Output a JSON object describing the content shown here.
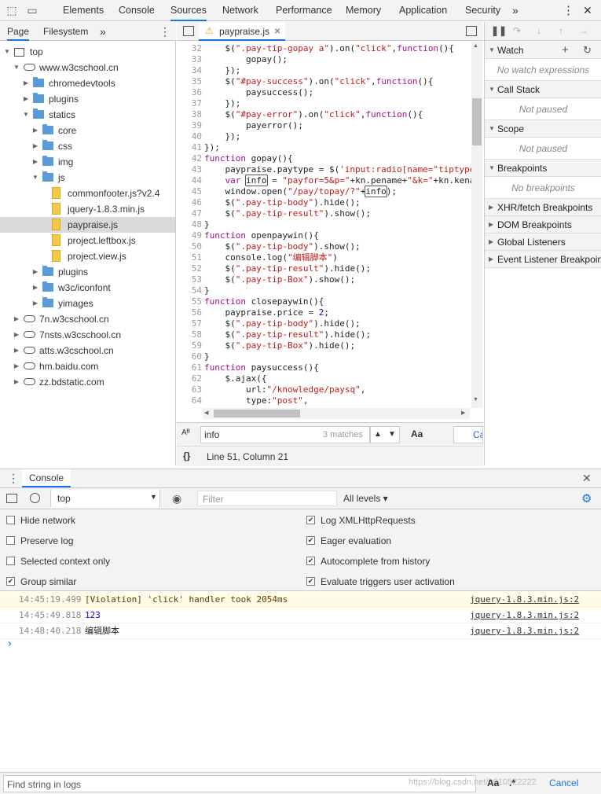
{
  "topbar": {
    "tabs": [
      "Elements",
      "Console",
      "Sources",
      "Network",
      "Performance",
      "Memory",
      "Application",
      "Security"
    ],
    "active": "Sources",
    "more": "»",
    "menu": "⋮",
    "close": "✕"
  },
  "navigator": {
    "tabs": [
      "Page",
      "Filesystem"
    ],
    "more": "»",
    "menu": "⋮",
    "tree": [
      {
        "label": "top",
        "icon": "frame",
        "depth": 0,
        "open": true
      },
      {
        "label": "www.w3cschool.cn",
        "icon": "cloud",
        "depth": 1,
        "open": true
      },
      {
        "label": "chromedevtools",
        "icon": "folder",
        "depth": 2,
        "open": false
      },
      {
        "label": "plugins",
        "icon": "folder",
        "depth": 2,
        "open": false
      },
      {
        "label": "statics",
        "icon": "folder",
        "depth": 2,
        "open": true
      },
      {
        "label": "core",
        "icon": "folder",
        "depth": 3,
        "open": false
      },
      {
        "label": "css",
        "icon": "folder",
        "depth": 3,
        "open": false
      },
      {
        "label": "img",
        "icon": "folder",
        "depth": 3,
        "open": false
      },
      {
        "label": "js",
        "icon": "folder",
        "depth": 3,
        "open": true
      },
      {
        "label": "commonfooter.js?v2.4",
        "icon": "file",
        "depth": 4
      },
      {
        "label": "jquery-1.8.3.min.js",
        "icon": "file",
        "depth": 4
      },
      {
        "label": "paypraise.js",
        "icon": "file",
        "depth": 4,
        "selected": true
      },
      {
        "label": "project.leftbox.js",
        "icon": "file",
        "depth": 4
      },
      {
        "label": "project.view.js",
        "icon": "file",
        "depth": 4
      },
      {
        "label": "plugins",
        "icon": "folder",
        "depth": 3,
        "open": false
      },
      {
        "label": "w3c/iconfont",
        "icon": "folder",
        "depth": 3,
        "open": false
      },
      {
        "label": "yimages",
        "icon": "folder",
        "depth": 3,
        "open": false
      },
      {
        "label": "7n.w3cschool.cn",
        "icon": "cloud",
        "depth": 1,
        "open": false
      },
      {
        "label": "7nsts.w3cschool.cn",
        "icon": "cloud",
        "depth": 1,
        "open": false
      },
      {
        "label": "atts.w3cschool.cn",
        "icon": "cloud",
        "depth": 1,
        "open": false
      },
      {
        "label": "hm.baidu.com",
        "icon": "cloud",
        "depth": 1,
        "open": false
      },
      {
        "label": "zz.bdstatic.com",
        "icon": "cloud",
        "depth": 1,
        "open": false
      }
    ]
  },
  "editor": {
    "file_tab": "paypraise.js",
    "warn_icon": "⚠",
    "close": "×",
    "lines": [
      {
        "n": "32",
        "html": "    $(<s>\".pay-tip-gopay a\"</s>).on(<s>\"click\"</s>,<k>function</k>(){"
      },
      {
        "n": "33",
        "html": "        gopay();"
      },
      {
        "n": "34",
        "html": "    });"
      },
      {
        "n": "35",
        "html": "    $(<s>\"#pay-success\"</s>).on(<s>\"click\"</s>,<k>function</k>(){"
      },
      {
        "n": "36",
        "html": "        paysuccess();"
      },
      {
        "n": "37",
        "html": "    });"
      },
      {
        "n": "38",
        "html": "    $(<s>\"#pay-error\"</s>).on(<s>\"click\"</s>,<k>function</k>(){"
      },
      {
        "n": "39",
        "html": "        payerror();"
      },
      {
        "n": "40",
        "html": "    });"
      },
      {
        "n": "41",
        "html": "});"
      },
      {
        "n": "42",
        "html": "<k>function</k> gopay(){"
      },
      {
        "n": "43",
        "html": "    paypraise.paytype = $(<s>'input:radio[name=\"tiptype</s>"
      },
      {
        "n": "44",
        "html": "    <k>var</k> <h>info</h> = <s>\"payfor=5&p=\"</s>+kn.pename+<s>\"&k=\"</s>+kn.kena"
      },
      {
        "n": "45",
        "html": "    window.open(<s>\"/pay/topay/?\"</s>+<h>info</h>);"
      },
      {
        "n": "46",
        "html": "    $(<s>\".pay-tip-body\"</s>).hide();"
      },
      {
        "n": "47",
        "html": "    $(<s>\".pay-tip-result\"</s>).show();"
      },
      {
        "n": "48",
        "html": "}"
      },
      {
        "n": "49",
        "html": "<k>function</k> openpaywin(){"
      },
      {
        "n": "50",
        "html": "    $(<s>\".pay-tip-body\"</s>).show();"
      },
      {
        "n": "51",
        "html": "    console.log(<s>\"编辑脚本\"</s>)"
      },
      {
        "n": "52",
        "html": "    $(<s>\".pay-tip-result\"</s>).hide();"
      },
      {
        "n": "53",
        "html": "    $(<s>\".pay-tip-Box\"</s>).show();"
      },
      {
        "n": "54",
        "html": "}"
      },
      {
        "n": "55",
        "html": "<k>function</k> closepaywin(){"
      },
      {
        "n": "56",
        "html": "    paypraise.price = <n>2</n>;"
      },
      {
        "n": "57",
        "html": "    $(<s>\".pay-tip-body\"</s>).hide();"
      },
      {
        "n": "58",
        "html": "    $(<s>\".pay-tip-result\"</s>).hide();"
      },
      {
        "n": "59",
        "html": "    $(<s>\".pay-tip-Box\"</s>).hide();"
      },
      {
        "n": "60",
        "html": "}"
      },
      {
        "n": "61",
        "html": "<k>function</k> paysuccess(){"
      },
      {
        "n": "62",
        "html": "    $.ajax({"
      },
      {
        "n": "63",
        "html": "        url:<s>\"/knowledge/paysq\"</s>,"
      },
      {
        "n": "64",
        "html": "        type:<s>\"post\"</s>,"
      },
      {
        "n": "65",
        "html": "        ..."
      }
    ],
    "search": {
      "value": "info",
      "matches": "3 matches",
      "aa": "Aa",
      ".star": ".*",
      "cancel": "Ca",
      "icon": "Aᴮ"
    },
    "status": {
      "braces": "{}",
      "position": "Line 51, Column 21"
    }
  },
  "right": {
    "sections": [
      {
        "title": "Watch",
        "body": "No watch expressions",
        "open": true,
        "icons": [
          "+",
          "↻"
        ]
      },
      {
        "title": "Call Stack",
        "body": "Not paused",
        "open": true
      },
      {
        "title": "Scope",
        "body": "Not paused",
        "open": true
      },
      {
        "title": "Breakpoints",
        "body": "No breakpoints",
        "open": true
      },
      {
        "title": "XHR/fetch Breakpoints",
        "open": false
      },
      {
        "title": "DOM Breakpoints",
        "open": false
      },
      {
        "title": "Global Listeners",
        "open": false
      },
      {
        "title": "Event Listener Breakpoints",
        "open": false
      }
    ]
  },
  "console": {
    "tab": "Console",
    "close": "✕",
    "context": "top",
    "filter_placeholder": "Filter",
    "levels": "All levels ▾",
    "settings_left": [
      {
        "label": "Hide network",
        "checked": false
      },
      {
        "label": "Preserve log",
        "checked": false
      },
      {
        "label": "Selected context only",
        "checked": false
      },
      {
        "label": "Group similar",
        "checked": true
      }
    ],
    "settings_right": [
      {
        "label": "Log XMLHttpRequests",
        "checked": true
      },
      {
        "label": "Eager evaluation",
        "checked": true
      },
      {
        "label": "Autocomplete from history",
        "checked": true
      },
      {
        "label": "Evaluate triggers user activation",
        "checked": true
      }
    ],
    "messages": [
      {
        "time": "14:45:19.499",
        "text": "[Violation] 'click' handler took 2054ms",
        "source": "jquery-1.8.3.min.js:2",
        "kind": "warn"
      },
      {
        "time": "14:45:49.818",
        "text": "123",
        "source": "jquery-1.8.3.min.js:2",
        "kind": "num"
      },
      {
        "time": "14:48:40.218",
        "text": "编辑脚本",
        "source": "jquery-1.8.3.min.js:2",
        "kind": "log"
      }
    ],
    "prompt": "›",
    "find_placeholder": "Find string in logs",
    "find_aa": "Aa",
    "find_star": ".*",
    "find_cancel": "Cancel",
    "watermark": "https://blog.csdn.net/u010522222"
  }
}
